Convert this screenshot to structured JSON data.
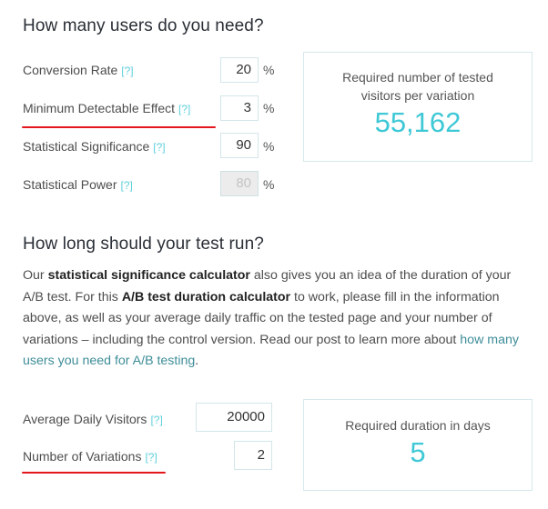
{
  "section1": {
    "title": "How many users do you need?",
    "help_label": "[?]",
    "percent_symbol": "%",
    "fields": [
      {
        "label": "Conversion Rate",
        "value": "20",
        "disabled": false
      },
      {
        "label": "Minimum Detectable Effect",
        "value": "3",
        "disabled": false,
        "highlighted": true
      },
      {
        "label": "Statistical Significance",
        "value": "90",
        "disabled": false
      },
      {
        "label": "Statistical Power",
        "value": "80",
        "disabled": true
      }
    ],
    "result": {
      "label_line1": "Required number of tested",
      "label_line2": "visitors per variation",
      "value": "55,162"
    }
  },
  "section2": {
    "title": "How long should your test run?",
    "paragraph": {
      "t1": "Our ",
      "b1": "statistical significance calculator",
      "t2": " also gives you an idea of the duration of your A/B test. For this ",
      "b2": "A/B test duration calculator",
      "t3": " to work, please fill in the information above, as well as your average daily traffic on the tested page and your number of variations – including the control version. Read our post to learn more about ",
      "link": "how many users you need for A/B testing",
      "t4": "."
    },
    "fields": [
      {
        "label": "Average Daily Visitors",
        "value": "20000"
      },
      {
        "label": "Number of Variations",
        "value": "2",
        "highlighted": true
      }
    ],
    "result": {
      "label": "Required duration in days",
      "value": "5"
    }
  },
  "colors": {
    "accent": "#3fc8d6",
    "help_link": "#5fcfdc",
    "annotation_underline": "#e3161c",
    "box_border": "#d6e8ec",
    "text_link": "#3e8d98"
  }
}
